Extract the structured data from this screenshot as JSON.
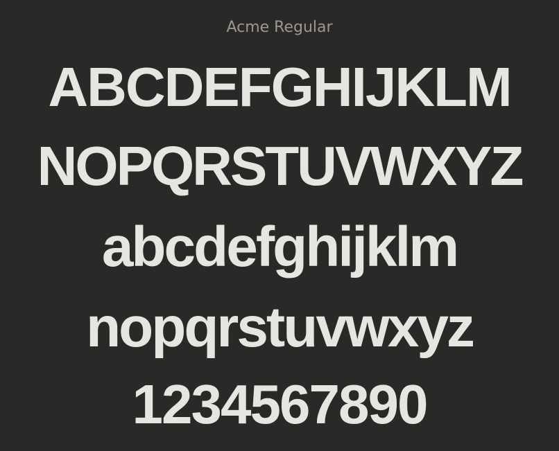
{
  "font_name": "Acme Regular",
  "specimen": {
    "uppercase_1": "ABCDEFGHIJKLM",
    "uppercase_2": "NOPQRSTUVWXYZ",
    "lowercase_1": "abcdefghijklm",
    "lowercase_2": "nopqrstuvwxyz",
    "digits": "1234567890"
  },
  "colors": {
    "background": "#2b2927",
    "glyph": "#e6e5e2",
    "title": "#9a9794"
  }
}
